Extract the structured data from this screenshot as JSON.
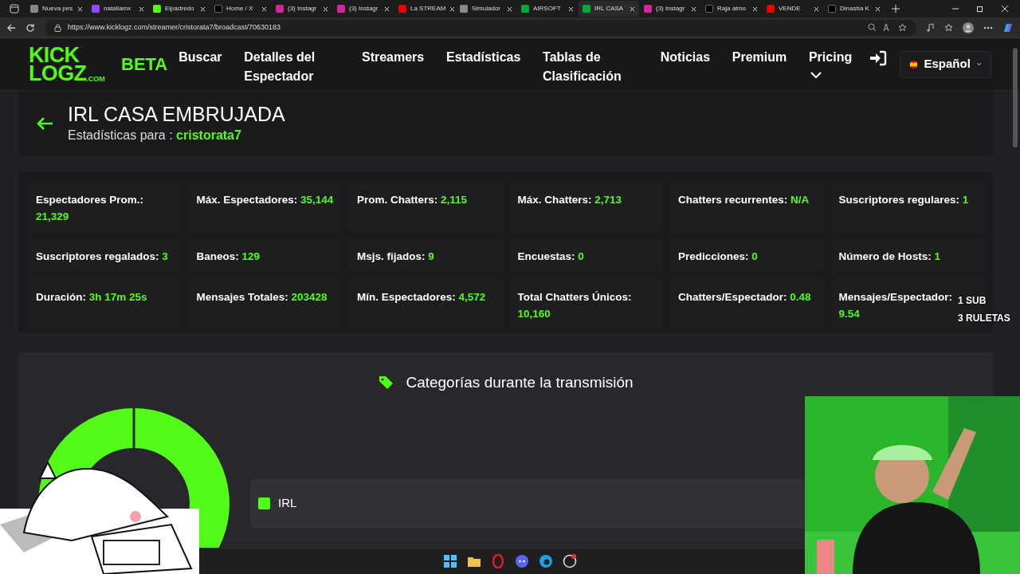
{
  "browser": {
    "tabs": [
      {
        "title": "Nueva pes",
        "kind": "page",
        "selected": false
      },
      {
        "title": "nataliamx",
        "kind": "video",
        "selected": false
      },
      {
        "title": "Elpadredo",
        "kind": "stream",
        "selected": false
      },
      {
        "title": "Home / X",
        "kind": "social",
        "selected": false
      },
      {
        "title": "(3) Instagr",
        "selected": false
      },
      {
        "title": "(3) Instagr",
        "selected": false
      },
      {
        "title": "La STREAM",
        "kind": "red",
        "selected": false
      },
      {
        "title": "Simulador",
        "kind": "page",
        "selected": false
      },
      {
        "title": "AIRSOFT",
        "kind": "stats",
        "selected": false
      },
      {
        "title": "IRL CASA",
        "kind": "stats",
        "selected": true
      },
      {
        "title": "(3) Instagr",
        "selected": false
      },
      {
        "title": "Raja almo",
        "kind": "social",
        "selected": false
      },
      {
        "title": "VENDE",
        "kind": "red",
        "selected": false
      },
      {
        "title": "Dinastía K",
        "kind": "social",
        "selected": false
      }
    ],
    "url": "https://www.kicklogz.com/streamer/cristorata7/broadcast/70630183"
  },
  "site": {
    "logo_top": "KICK",
    "logo_bottom": "LOGZ",
    "logo_suffix": ".COM",
    "badge": "BETA",
    "nav": [
      {
        "label": "Buscar",
        "kind": "link"
      },
      {
        "label": "Detalles del Espectador",
        "kind": "link"
      },
      {
        "label": "Streamers",
        "kind": "link"
      },
      {
        "label": "Estadísticas",
        "kind": "link"
      },
      {
        "label": "Tablas de Clasificación",
        "kind": "link"
      },
      {
        "label": "Noticias",
        "kind": "link"
      },
      {
        "label": "Premium",
        "kind": "link"
      },
      {
        "label": "Pricing",
        "kind": "dropdown"
      }
    ],
    "language": "Español"
  },
  "broadcast": {
    "title": "IRL CASA EMBRUJADA",
    "subtitle": "Estadísticas para :",
    "streamer": "cristorata7"
  },
  "stats": [
    {
      "label": "Espectadores Prom.:",
      "value": "21,329"
    },
    {
      "label": "Máx. Espectadores:",
      "value": "35,144"
    },
    {
      "label": "Prom. Chatters:",
      "value": "2,115"
    },
    {
      "label": "Máx. Chatters:",
      "value": "2,713"
    },
    {
      "label": "Chatters recurrentes:",
      "value": "N/A"
    },
    {
      "label": "Suscriptores regulares:",
      "value": "1"
    },
    {
      "label": "Suscriptores regalados:",
      "value": "3"
    },
    {
      "label": "Baneos:",
      "value": "129"
    },
    {
      "label": "Msjs. fijados:",
      "value": "9"
    },
    {
      "label": "Encuestas:",
      "value": "0"
    },
    {
      "label": "Predicciones:",
      "value": "0"
    },
    {
      "label": "Número de Hosts:",
      "value": "1"
    },
    {
      "label": "Duración:",
      "value": "3h 17m 25s"
    },
    {
      "label": "Mensajes Totales:",
      "value": "203428"
    },
    {
      "label": "Mín. Espectadores:",
      "value": "4,572"
    },
    {
      "label": "Total Chatters Únicos:",
      "value": "10,160"
    },
    {
      "label": "Chatters/Espectador:",
      "value": "0.48"
    },
    {
      "label": "Mensajes/Espectador:",
      "value": "9.54"
    }
  ],
  "categories": {
    "title": "Categorías durante la transmisión",
    "legend": [
      {
        "label": "IRL",
        "color": "#53fc18"
      }
    ]
  },
  "stream_overlay": {
    "lines": [
      "1 SUB",
      "3 RULETAS"
    ]
  },
  "taskbar": {
    "apps": [
      {
        "kind": "start"
      },
      {
        "kind": "folder"
      },
      {
        "kind": "opera"
      },
      {
        "kind": "discord"
      },
      {
        "kind": "edge"
      },
      {
        "kind": "obs"
      }
    ]
  }
}
